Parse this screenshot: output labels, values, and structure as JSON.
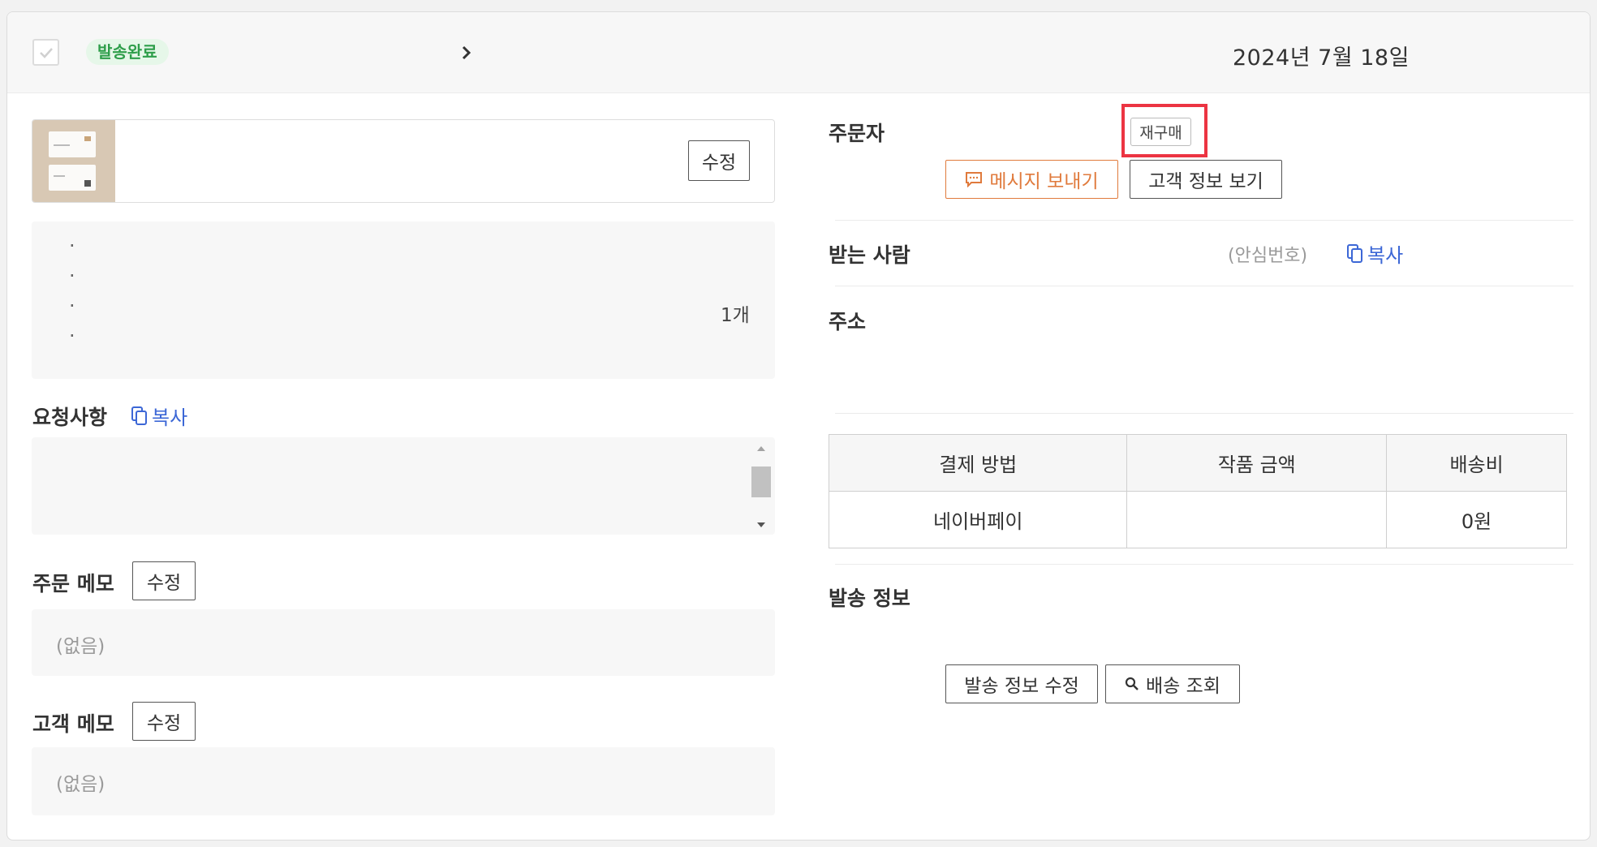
{
  "header": {
    "status": "발송완료",
    "date": "2024년 7월 18일"
  },
  "product": {
    "edit_label": "수정",
    "quantity": "1개"
  },
  "request": {
    "label": "요청사항",
    "copy_label": "복사"
  },
  "order_memo": {
    "label": "주문 메모",
    "edit_label": "수정",
    "value": "(없음)"
  },
  "customer_memo": {
    "label": "고객 메모",
    "edit_label": "수정",
    "value": "(없음)"
  },
  "orderer": {
    "label": "주문자",
    "rebuy_badge": "재구매",
    "message_button": "메시지 보내기",
    "customer_info_button": "고객 정보 보기"
  },
  "recipient": {
    "label": "받는 사람",
    "safe_number": "(안심번호)",
    "copy_label": "복사"
  },
  "address": {
    "label": "주소"
  },
  "payment_table": {
    "headers": [
      "결제 방법",
      "작품 금액",
      "배송비"
    ],
    "row": [
      "네이버페이",
      "",
      "0원"
    ]
  },
  "shipping": {
    "label": "발송 정보",
    "edit_button": "발송 정보 수정",
    "track_button": "배송 조회"
  },
  "colors": {
    "status_green": "#2e9e4a",
    "link_blue": "#3c67d6",
    "message_orange": "#e07a3c",
    "highlight_red": "#ec3442"
  }
}
